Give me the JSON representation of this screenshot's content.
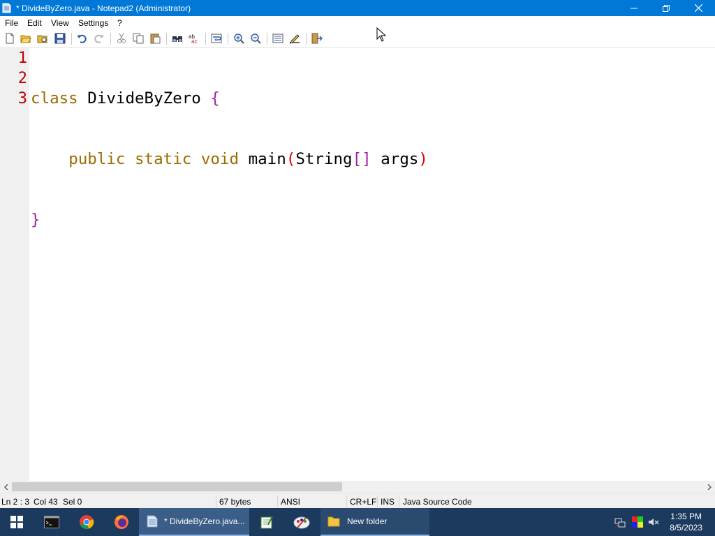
{
  "window": {
    "title": "* DivideByZero.java - Notepad2 (Administrator)",
    "controls": [
      "minimize",
      "restore",
      "close"
    ]
  },
  "menu": {
    "items": [
      "File",
      "Edit",
      "View",
      "Settings",
      "?"
    ]
  },
  "toolbar": {
    "icons": [
      "new-file-icon",
      "open-icon",
      "browse-icon",
      "save-icon",
      "undo-icon",
      "redo-icon",
      "cut-icon",
      "copy-icon",
      "paste-icon",
      "find-icon",
      "replace-icon",
      "word-wrap-icon",
      "zoom-in-icon",
      "zoom-out-icon",
      "scheme-icon",
      "customize-icon",
      "exit-icon"
    ]
  },
  "editor": {
    "line_numbers": [
      "1",
      "2",
      "3"
    ],
    "lines": [
      {
        "keyword1": "class",
        "text1": " DivideByZero ",
        "brace": "{"
      },
      {
        "indent": "    ",
        "kw_public": "public",
        "kw_static": "static",
        "kw_void": "void",
        "name": "main",
        "paren_open": "(",
        "type": "String",
        "brackets": "[]",
        "arg": " args",
        "paren_close": ")"
      },
      {
        "brace": "}"
      }
    ],
    "colors": {
      "keyword": "#9a6c00",
      "brace": "#a020a0",
      "paren": "#e00000",
      "line_number": "#c00000"
    }
  },
  "statusbar": {
    "position": "Ln 2 : 3",
    "column": "Col 43",
    "selection": "Sel 0",
    "size": "67 bytes",
    "encoding": "ANSI",
    "line_endings": "CR+LF",
    "mode": "INS",
    "language": "Java Source Code"
  },
  "taskbar": {
    "start_icon": "windows-start-icon",
    "apps": [
      {
        "name": "cmd-icon"
      },
      {
        "name": "chrome-icon"
      },
      {
        "name": "firefox-icon"
      },
      {
        "name": "notepad2-icon",
        "label": "* DivideByZero.java..."
      },
      {
        "name": "notepad-plus-icon"
      },
      {
        "name": "paint-icon"
      },
      {
        "name": "folder-icon",
        "label": "New folder"
      }
    ],
    "time": "1:35 PM",
    "date": "8/5/2023"
  }
}
